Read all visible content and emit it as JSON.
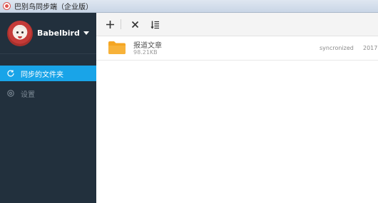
{
  "window": {
    "title": "巴别鸟同步端（企业版）"
  },
  "profile": {
    "username": "Babelbird"
  },
  "sidebar": {
    "items": [
      {
        "label": "同步的文件夹",
        "icon": "sync-icon",
        "active": true
      },
      {
        "label": "设置",
        "icon": "gear-icon",
        "active": false
      }
    ]
  },
  "toolbar": {
    "buttons": [
      {
        "icon": "plus-icon",
        "action": "add"
      },
      {
        "icon": "close-icon",
        "action": "remove"
      },
      {
        "icon": "list-sort-icon",
        "action": "sort"
      }
    ]
  },
  "files": [
    {
      "name": "报道文章",
      "size": "98.21KB",
      "status": "syncronized",
      "date": "2017",
      "icon": "folder-icon"
    }
  ],
  "colors": {
    "sidebar": "#22303d",
    "accent": "#19a4e8",
    "folder": "#f5a623"
  }
}
